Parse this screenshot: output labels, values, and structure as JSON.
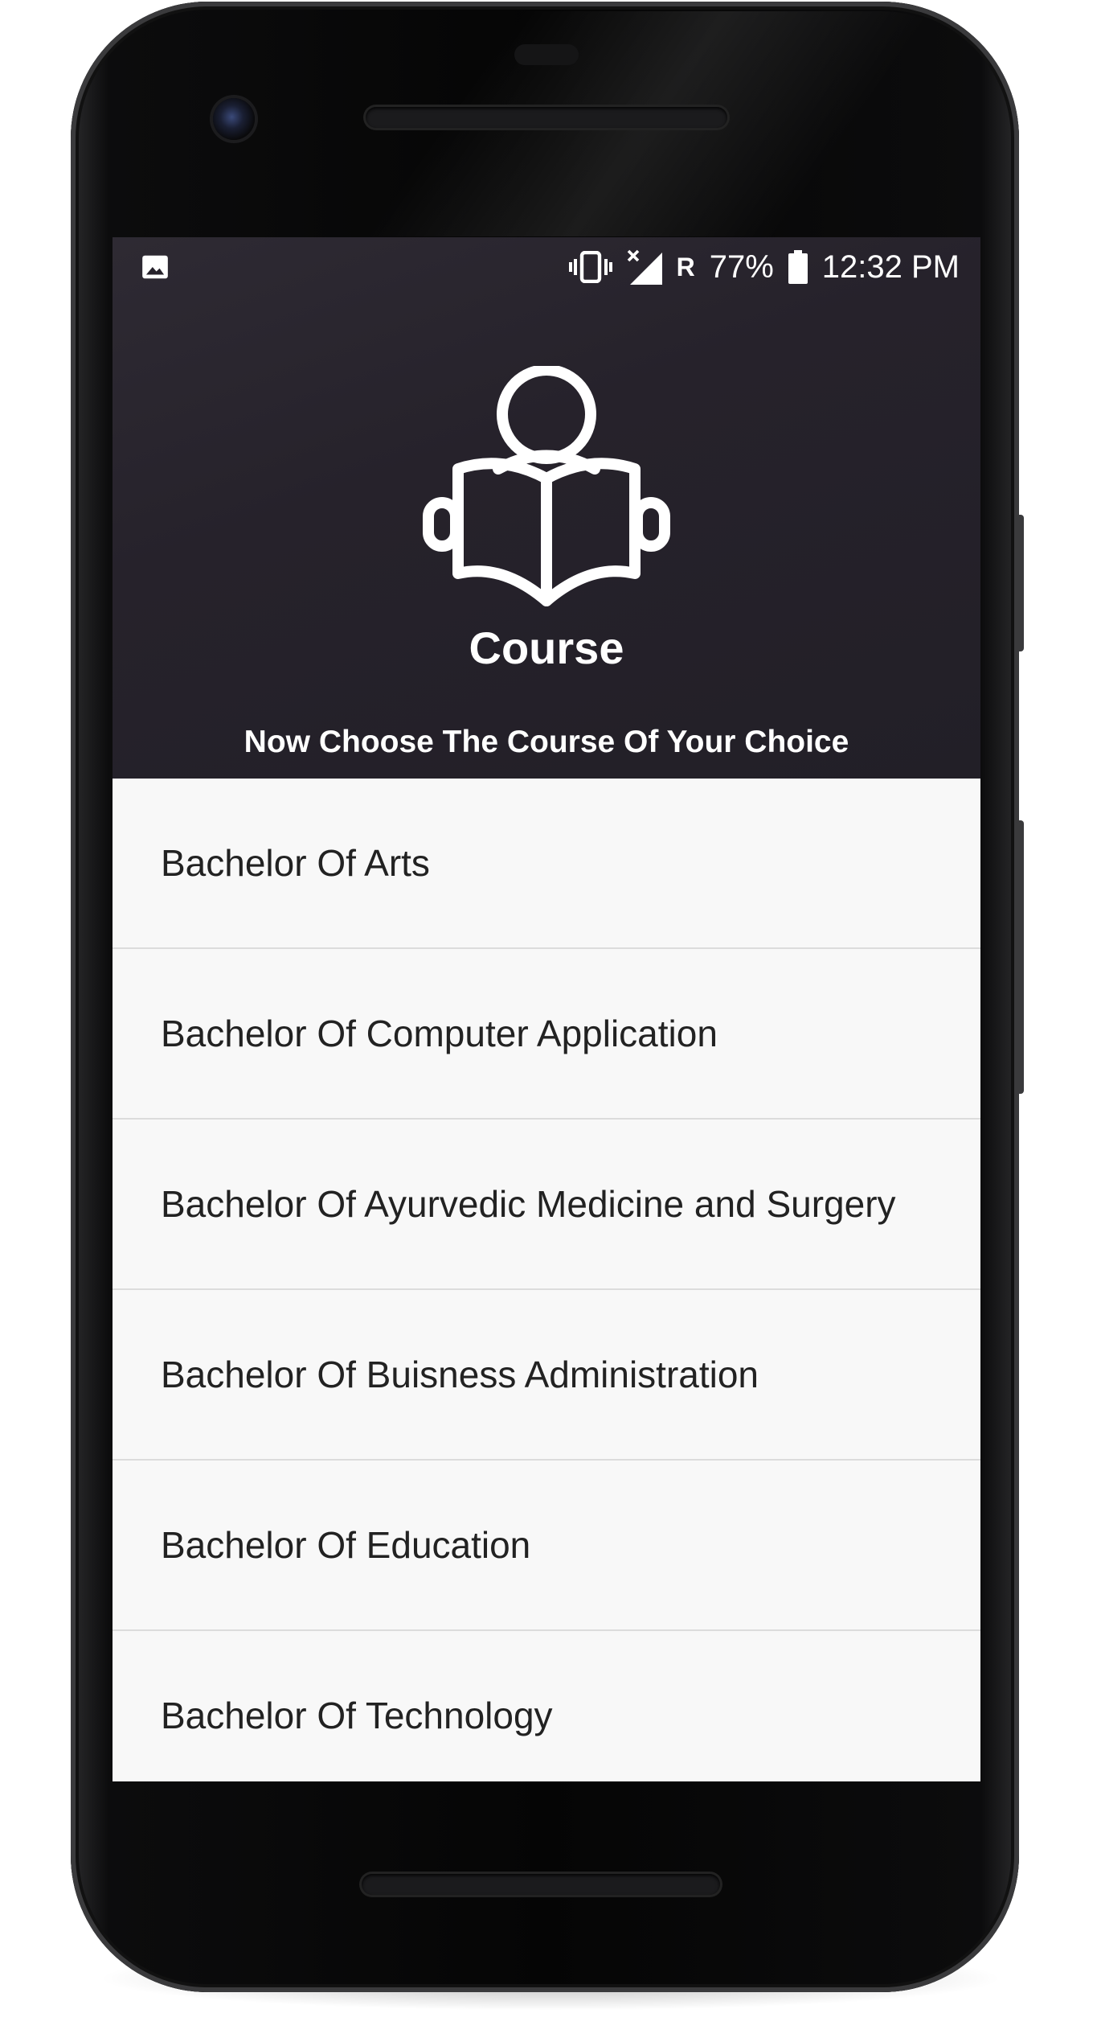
{
  "status_bar": {
    "left_icon": "image-icon",
    "icons": [
      "vibrate-icon",
      "no-signal-icon"
    ],
    "network_indicator": "R",
    "battery_percent": "77%",
    "battery_icon": "battery-icon",
    "time": "12:32 PM"
  },
  "header": {
    "icon": "reader-book-icon",
    "title": "Course",
    "subtitle": "Now Choose The Course Of Your Choice"
  },
  "courses": [
    {
      "label": "Bachelor Of Arts"
    },
    {
      "label": "Bachelor Of Computer Application"
    },
    {
      "label": "Bachelor Of Ayurvedic Medicine and Surgery"
    },
    {
      "label": "Bachelor Of Buisness Administration"
    },
    {
      "label": "Bachelor Of Education"
    },
    {
      "label": "Bachelor Of Technology"
    }
  ],
  "colors": {
    "header_background": "#26222b",
    "header_text": "#ffffff",
    "list_background": "#f8f8f8",
    "list_text": "#222222",
    "divider": "#dcdcdc"
  }
}
